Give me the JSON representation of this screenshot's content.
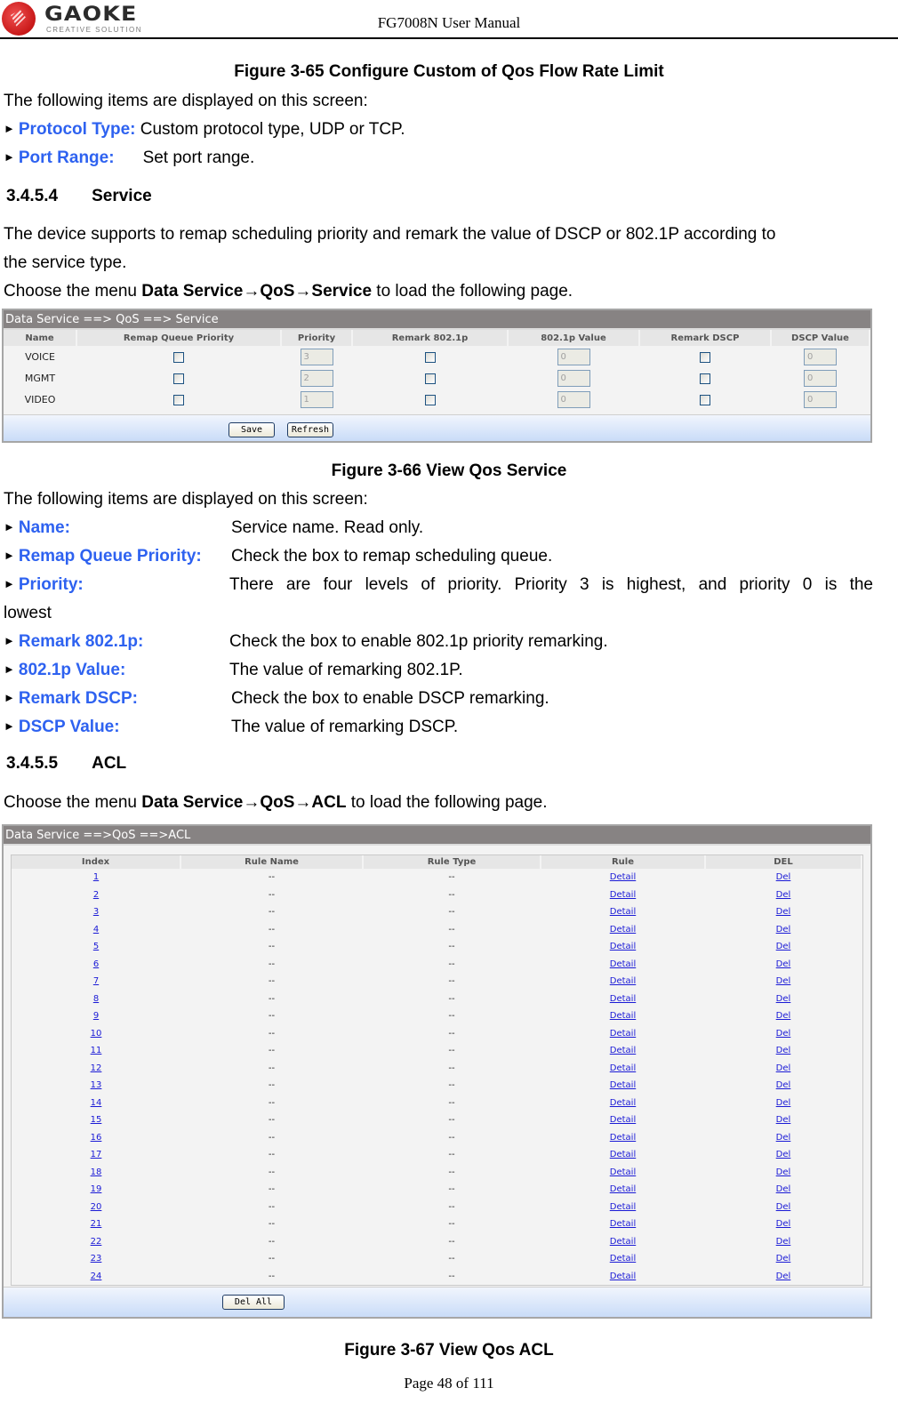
{
  "header": {
    "logo_text": "GAOKE",
    "logo_subtext": "CREATIVE SOLUTION",
    "doc_title": "FG7008N User Manual"
  },
  "fig65_caption": "Figure 3-65   Configure Custom of Qos Flow Rate Limit",
  "intro1": "The following items are displayed on this screen:",
  "items1": [
    {
      "label": "Protocol Type:",
      "desc": "Custom protocol type, UDP or TCP."
    },
    {
      "label": "Port Range:",
      "desc": "Set port range."
    }
  ],
  "section_service": {
    "number": "3.4.5.4",
    "title": "Service"
  },
  "service_para_line1": "The device supports to remap scheduling priority and remark the value of DSCP or 802.1P according to",
  "service_para_line2": "the service type.",
  "service_menu": {
    "prefix": "Choose the menu ",
    "path": "Data Service→QoS→Service",
    "suffix": " to load the following page."
  },
  "service_screen": {
    "title": "Data Service ==> QoS ==> Service",
    "columns": [
      "Name",
      "Remap Queue Priority",
      "Priority",
      "Remark 802.1p",
      "802.1p Value",
      "Remark DSCP",
      "DSCP Value"
    ],
    "rows": [
      {
        "name": "VOICE",
        "remap": false,
        "priority": "3",
        "remark_8021p": false,
        "value_8021p": "0",
        "remark_dscp": false,
        "dscp_value": "0"
      },
      {
        "name": "MGMT",
        "remap": false,
        "priority": "2",
        "remark_8021p": false,
        "value_8021p": "0",
        "remark_dscp": false,
        "dscp_value": "0"
      },
      {
        "name": "VIDEO",
        "remap": false,
        "priority": "1",
        "remark_8021p": false,
        "value_8021p": "0",
        "remark_dscp": false,
        "dscp_value": "0"
      }
    ],
    "save_label": "Save",
    "refresh_label": "Refresh"
  },
  "fig66_caption": "Figure 3-66   View Qos Service",
  "intro2": "The following items are displayed on this screen:",
  "items2": [
    {
      "label": "Name:",
      "desc": "Service name. Read only."
    },
    {
      "label": "Remap Queue Priority:",
      "desc": "Check the box to remap scheduling queue."
    },
    {
      "label": "Priority:",
      "desc": "There  are  four  levels  of  priority.  Priority  3  is  highest,  and  priority  0  is  the",
      "desc_cont": "lowest"
    },
    {
      "label": "Remark 802.1p:",
      "desc": "Check the box to enable 802.1p priority remarking."
    },
    {
      "label": "802.1p Value:",
      "desc": "The value of remarking 802.1P."
    },
    {
      "label": "Remark DSCP:",
      "desc": "Check the box to enable DSCP remarking."
    },
    {
      "label": "DSCP Value:",
      "desc": "The value of remarking DSCP."
    }
  ],
  "section_acl": {
    "number": "3.4.5.5",
    "title": "ACL"
  },
  "acl_menu": {
    "prefix": "Choose the menu ",
    "path": "Data Service→QoS→ACL",
    "suffix": " to load the following page."
  },
  "acl_screen": {
    "title": "Data Service ==>QoS ==>ACL",
    "columns": [
      "Index",
      "Rule Name",
      "Rule Type",
      "Rule",
      "DEL"
    ],
    "rows": [
      {
        "index": "1",
        "rule_name": "--",
        "rule_type": "--",
        "rule": "Detail",
        "del": "Del"
      },
      {
        "index": "2",
        "rule_name": "--",
        "rule_type": "--",
        "rule": "Detail",
        "del": "Del"
      },
      {
        "index": "3",
        "rule_name": "--",
        "rule_type": "--",
        "rule": "Detail",
        "del": "Del"
      },
      {
        "index": "4",
        "rule_name": "--",
        "rule_type": "--",
        "rule": "Detail",
        "del": "Del"
      },
      {
        "index": "5",
        "rule_name": "--",
        "rule_type": "--",
        "rule": "Detail",
        "del": "Del"
      },
      {
        "index": "6",
        "rule_name": "--",
        "rule_type": "--",
        "rule": "Detail",
        "del": "Del"
      },
      {
        "index": "7",
        "rule_name": "--",
        "rule_type": "--",
        "rule": "Detail",
        "del": "Del"
      },
      {
        "index": "8",
        "rule_name": "--",
        "rule_type": "--",
        "rule": "Detail",
        "del": "Del"
      },
      {
        "index": "9",
        "rule_name": "--",
        "rule_type": "--",
        "rule": "Detail",
        "del": "Del"
      },
      {
        "index": "10",
        "rule_name": "--",
        "rule_type": "--",
        "rule": "Detail",
        "del": "Del"
      },
      {
        "index": "11",
        "rule_name": "--",
        "rule_type": "--",
        "rule": "Detail",
        "del": "Del"
      },
      {
        "index": "12",
        "rule_name": "--",
        "rule_type": "--",
        "rule": "Detail",
        "del": "Del"
      },
      {
        "index": "13",
        "rule_name": "--",
        "rule_type": "--",
        "rule": "Detail",
        "del": "Del"
      },
      {
        "index": "14",
        "rule_name": "--",
        "rule_type": "--",
        "rule": "Detail",
        "del": "Del"
      },
      {
        "index": "15",
        "rule_name": "--",
        "rule_type": "--",
        "rule": "Detail",
        "del": "Del"
      },
      {
        "index": "16",
        "rule_name": "--",
        "rule_type": "--",
        "rule": "Detail",
        "del": "Del"
      },
      {
        "index": "17",
        "rule_name": "--",
        "rule_type": "--",
        "rule": "Detail",
        "del": "Del"
      },
      {
        "index": "18",
        "rule_name": "--",
        "rule_type": "--",
        "rule": "Detail",
        "del": "Del"
      },
      {
        "index": "19",
        "rule_name": "--",
        "rule_type": "--",
        "rule": "Detail",
        "del": "Del"
      },
      {
        "index": "20",
        "rule_name": "--",
        "rule_type": "--",
        "rule": "Detail",
        "del": "Del"
      },
      {
        "index": "21",
        "rule_name": "--",
        "rule_type": "--",
        "rule": "Detail",
        "del": "Del"
      },
      {
        "index": "22",
        "rule_name": "--",
        "rule_type": "--",
        "rule": "Detail",
        "del": "Del"
      },
      {
        "index": "23",
        "rule_name": "--",
        "rule_type": "--",
        "rule": "Detail",
        "del": "Del"
      },
      {
        "index": "24",
        "rule_name": "--",
        "rule_type": "--",
        "rule": "Detail",
        "del": "Del"
      }
    ],
    "del_all_label": "Del All"
  },
  "fig67_caption": "Figure 3-67   View Qos ACL",
  "footer": {
    "page_label": "Page 48 of 111"
  },
  "colors": {
    "highlight_label": "#2e62f0",
    "link": "#1a1ad6",
    "title_bar": "#878383"
  }
}
